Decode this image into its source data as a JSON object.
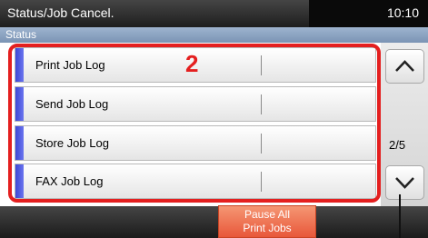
{
  "header": {
    "title": "Status/Job Cancel.",
    "clock": "10:10"
  },
  "subheader": {
    "label": "Status"
  },
  "jobs": [
    {
      "label": "Print Job Log"
    },
    {
      "label": "Send Job Log"
    },
    {
      "label": "Store Job Log"
    },
    {
      "label": "FAX Job Log"
    }
  ],
  "pager": {
    "page": "2/5"
  },
  "callout": {
    "number": "2"
  },
  "actions": {
    "pause_all_line1": "Pause All",
    "pause_all_line2": "Print Jobs"
  },
  "colors": {
    "accent_blue": "#3d48d6",
    "highlight_red": "#e41f1f",
    "pause_orange": "#ec6a47"
  }
}
